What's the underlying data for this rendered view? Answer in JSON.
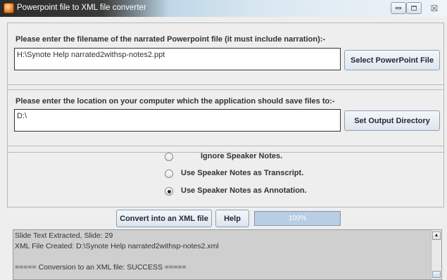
{
  "window": {
    "title": "Powerpoint file to XML file converter",
    "icon": "powerpoint-app-icon",
    "controls": {
      "minimize_icon": "minimize-icon",
      "maximize_icon": "maximize-icon",
      "close_glyph": "☒"
    }
  },
  "input_section": {
    "label": "Please enter the filename of the narrated Powerpoint file (it must include narration):-",
    "value": "H:\\Synote Help narrated2withsp-notes2.ppt",
    "button_label": "Select PowerPoint File"
  },
  "output_section": {
    "label": "Please enter the location on your computer which the application should save files to:-",
    "value": "D:\\",
    "button_label": "Set Output Directory"
  },
  "speaker_notes_options": {
    "selected_index": 2,
    "options": [
      {
        "label": "Ignore Speaker Notes.",
        "checked": false
      },
      {
        "label": "Use Speaker Notes as Transcript.",
        "checked": false
      },
      {
        "label": "Use Speaker Notes as Annotation.",
        "checked": true
      }
    ]
  },
  "actions": {
    "convert_label": "Convert into an XML file",
    "help_label": "Help",
    "progress_text": "100%",
    "progress_value": 1.0
  },
  "log": {
    "lines": [
      "Slide Text Extracted, Slide: 29",
      "XML File Created: D:\\Synote Help narrated2withsp-notes2.xml",
      "",
      "===== Conversion to an XML file: SUCCESS ====="
    ]
  },
  "colors": {
    "window_bg": "#eeeeee",
    "log_bg": "#cfcfcf",
    "progress_bar": "#b9cde3",
    "button_text": "#222a3a"
  }
}
